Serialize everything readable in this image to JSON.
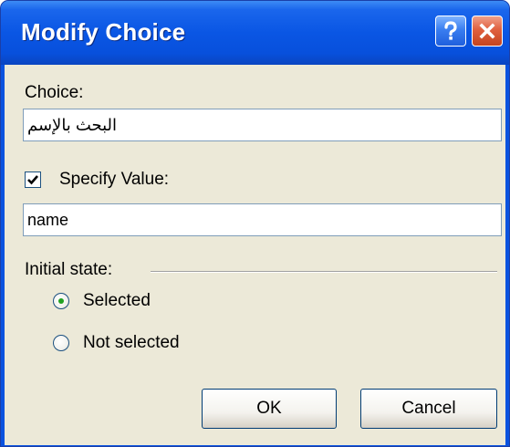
{
  "window": {
    "title": "Modify Choice",
    "help_label": "?",
    "close_label": "✕"
  },
  "choice": {
    "label": "Choice:",
    "value": "البحث بالإسم"
  },
  "specify_value": {
    "label": "Specify Value:",
    "checked": true,
    "value": "name"
  },
  "initial_state": {
    "label": "Initial state:",
    "options": [
      {
        "label": "Selected",
        "selected": true
      },
      {
        "label": "Not selected",
        "selected": false
      }
    ]
  },
  "buttons": {
    "ok": "OK",
    "cancel": "Cancel"
  },
  "colors": {
    "titlebar": "#0a56e4",
    "dialog_bg": "#ece9d8",
    "radio_dot": "#21a121"
  }
}
